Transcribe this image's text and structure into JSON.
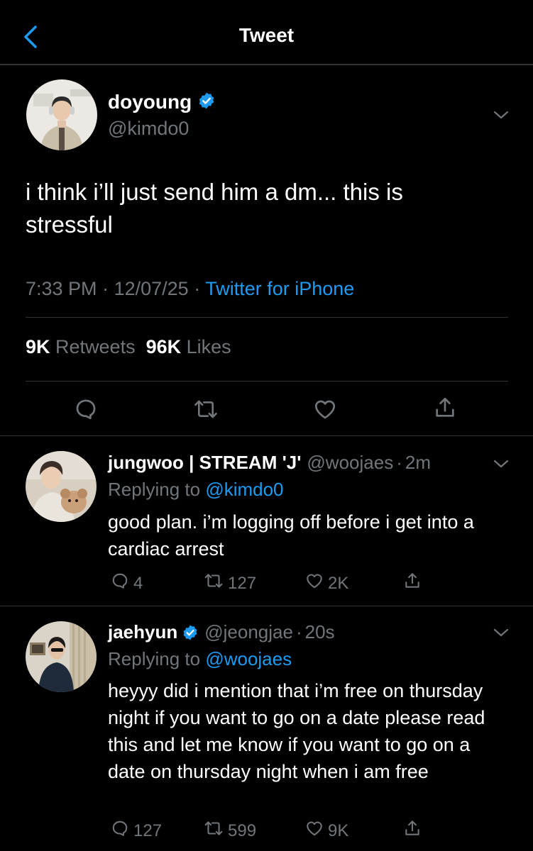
{
  "header": {
    "title": "Tweet"
  },
  "main_tweet": {
    "name": "doyoung",
    "handle": "@kimdo0",
    "text": "i think i’ll just send him a dm... this is stressful",
    "time": "7:33 PM",
    "date": "12/07/25",
    "source": "Twitter for iPhone",
    "retweets_count": "9K",
    "retweets_label": "Retweets",
    "likes_count": "96K",
    "likes_label": "Likes"
  },
  "replies": [
    {
      "name": "jungwoo | STREAM 'J'",
      "handle": "@woojaes",
      "age": "2m",
      "replying_label": "Replying to",
      "replying_to": "@kimdo0",
      "text": "good plan. i’m logging off before i get into a cardiac arrest",
      "replies": "4",
      "retweets": "127",
      "likes": "2K"
    },
    {
      "name": "jaehyun",
      "handle": "@jeongjae",
      "age": "20s",
      "replying_label": "Replying to",
      "replying_to": "@woojaes",
      "text": "heyyy did i mention that i’m free on thursday night if you want to go on a date please read this and let me know if you want to go on a date on thursday night when i am free",
      "replies": "127",
      "retweets": "599",
      "likes": "9K"
    }
  ],
  "colors": {
    "accent": "#1d9bf0",
    "muted": "#71767b",
    "background": "#000000",
    "divider": "#2f3336"
  },
  "icons": [
    "back-chevron-icon",
    "verified-badge-icon",
    "chevron-down-icon",
    "reply-icon",
    "retweet-icon",
    "like-icon",
    "share-icon"
  ]
}
